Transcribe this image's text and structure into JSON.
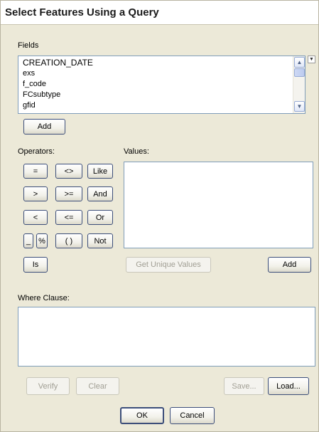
{
  "window": {
    "title": "Select Features Using a Query"
  },
  "fields": {
    "label": "Fields",
    "items": [
      "CREATION_DATE",
      "exs",
      "f_code",
      "FCsubtype",
      "gfid"
    ],
    "add_label": "Add"
  },
  "operators": {
    "label": "Operators:",
    "buttons": [
      "=",
      "<>",
      "Like",
      ">",
      ">=",
      "And",
      "<",
      "<=",
      "Or",
      "_",
      "%",
      "( )",
      "Not",
      "Is"
    ]
  },
  "values": {
    "label": "Values:",
    "get_unique_label": "Get Unique Values",
    "add_label": "Add"
  },
  "where": {
    "label": "Where Clause:"
  },
  "actions": {
    "verify_label": "Verify",
    "clear_label": "Clear",
    "save_label": "Save...",
    "load_label": "Load...",
    "ok_label": "OK",
    "cancel_label": "Cancel"
  }
}
